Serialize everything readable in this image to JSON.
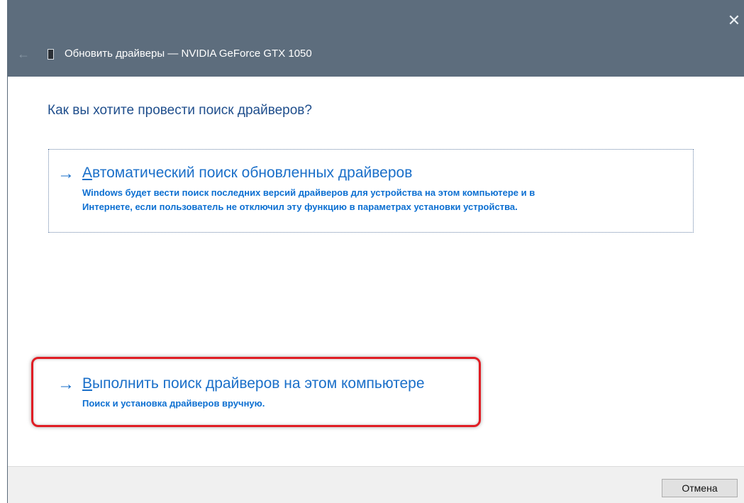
{
  "window": {
    "title": "Обновить драйверы — NVIDIA GeForce GTX 1050",
    "close_glyph": "✕",
    "back_glyph": "←",
    "titlebar_color": "#5d6d7d"
  },
  "main": {
    "question": "Как вы хотите провести поиск драйверов?",
    "options": [
      {
        "arrow": "→",
        "title_first_letter": "А",
        "title_rest": "втоматический поиск обновленных драйверов",
        "desc_line1": "Windows будет вести поиск последних версий драйверов для устройства на этом компьютере и в",
        "desc_line2": "Интернете, если пользователь не отключил эту функцию в параметрах установки устройства."
      },
      {
        "arrow": "→",
        "title_first_letter": "В",
        "title_rest": "ыполнить поиск драйверов на этом компьютере",
        "desc_line1": "Поиск и установка драйверов вручную.",
        "highlighted": true
      }
    ],
    "link_color": "#1a6fc9",
    "highlight_color": "#e01d24"
  },
  "footer": {
    "cancel_label": "Отмена"
  }
}
